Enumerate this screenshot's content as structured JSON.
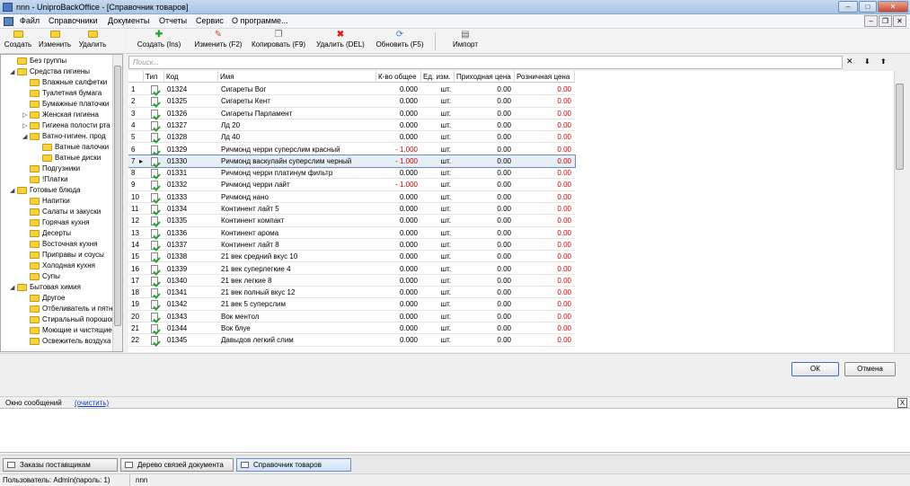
{
  "window": {
    "title": "nnn - UniproBackOffice - [Справочник товаров]",
    "min": "–",
    "max": "□",
    "close": "✕"
  },
  "menu": [
    "Файл",
    "Справочники",
    "Документы",
    "Отчеты",
    "Сервис",
    "О программе..."
  ],
  "mdi": {
    "min": "–",
    "restore": "❐",
    "close": "✕"
  },
  "tree_toolbar": [
    "Создать",
    "Изменить",
    "Удалить"
  ],
  "main_toolbar": [
    "Создать (Ins)",
    "Изменить (F2)",
    "Копировать (F9)",
    "Удалить (DEL)",
    "Обновить (F5)",
    "Импорт"
  ],
  "icons": {
    "create": "plus-icon",
    "edit": "pencil-icon",
    "copy": "copy-icon",
    "delete": "red-x-icon",
    "refresh": "refresh-icon",
    "import": "import-icon"
  },
  "search": {
    "placeholder": "Поиск...",
    "clear": "✕",
    "down": "⬇",
    "up": "⬆"
  },
  "tree": [
    {
      "label": "Без группы",
      "level": 0,
      "expander": ""
    },
    {
      "label": "Средства гигиены",
      "level": 0,
      "expander": "◢"
    },
    {
      "label": "Влажные салфетки",
      "level": 1,
      "expander": ""
    },
    {
      "label": "Туалетная бумага",
      "level": 1,
      "expander": ""
    },
    {
      "label": "Бумажные платочки",
      "level": 1,
      "expander": ""
    },
    {
      "label": "Женская гигиена",
      "level": 1,
      "expander": "▷"
    },
    {
      "label": "Гигиена полости рта",
      "level": 1,
      "expander": "▷"
    },
    {
      "label": "Ватно-гигиен. прод",
      "level": 1,
      "expander": "◢"
    },
    {
      "label": "Ватные палочки",
      "level": 2,
      "expander": ""
    },
    {
      "label": "Ватные диски",
      "level": 2,
      "expander": ""
    },
    {
      "label": "Подгузники",
      "level": 1,
      "expander": ""
    },
    {
      "label": "!Платки",
      "level": 1,
      "expander": ""
    },
    {
      "label": "Готовые блюда",
      "level": 0,
      "expander": "◢"
    },
    {
      "label": "Напитки",
      "level": 1,
      "expander": ""
    },
    {
      "label": "Салаты и закуски",
      "level": 1,
      "expander": ""
    },
    {
      "label": "Горячая кухня",
      "level": 1,
      "expander": ""
    },
    {
      "label": "Десерты",
      "level": 1,
      "expander": ""
    },
    {
      "label": "Восточная кухня",
      "level": 1,
      "expander": ""
    },
    {
      "label": "Приправы и соусы",
      "level": 1,
      "expander": ""
    },
    {
      "label": "Холодная кухня",
      "level": 1,
      "expander": ""
    },
    {
      "label": "Супы",
      "level": 1,
      "expander": ""
    },
    {
      "label": "Бытовая химия",
      "level": 0,
      "expander": "◢"
    },
    {
      "label": "Другое",
      "level": 1,
      "expander": ""
    },
    {
      "label": "Отбеливатель и пятно",
      "level": 1,
      "expander": ""
    },
    {
      "label": "Стиральный порошок",
      "level": 1,
      "expander": ""
    },
    {
      "label": "Моющие и чистящие",
      "level": 1,
      "expander": ""
    },
    {
      "label": "Освежитель воздуха",
      "level": 1,
      "expander": ""
    }
  ],
  "grid": {
    "columns": [
      "Тип",
      "Код",
      "Имя",
      "К-во общее",
      "Ед. изм.",
      "Приходная цена",
      "Розничная цена"
    ],
    "selected_marker": "▸",
    "rows": [
      {
        "n": "1",
        "code": "01324",
        "name": "Сигареты Вог",
        "qty": "0.000",
        "unit": "шт.",
        "in": "0.00",
        "retail": "0.00"
      },
      {
        "n": "2",
        "code": "01325",
        "name": "Сигареты Кент",
        "qty": "0.000",
        "unit": "шт.",
        "in": "0.00",
        "retail": "0.00"
      },
      {
        "n": "3",
        "code": "01326",
        "name": "Сигареты Парламент",
        "qty": "0.000",
        "unit": "шт.",
        "in": "0.00",
        "retail": "0.00"
      },
      {
        "n": "4",
        "code": "01327",
        "name": "Лд 20",
        "qty": "0.000",
        "unit": "шт.",
        "in": "0.00",
        "retail": "0.00"
      },
      {
        "n": "5",
        "code": "01328",
        "name": "Лд 40",
        "qty": "0.000",
        "unit": "шт.",
        "in": "0.00",
        "retail": "0.00"
      },
      {
        "n": "6",
        "code": "01329",
        "name": "Ричмонд черри суперслим красный",
        "qty": "- 1.000",
        "unit": "шт.",
        "in": "0.00",
        "retail": "0.00",
        "neg": true
      },
      {
        "n": "7",
        "code": "01330",
        "name": "Ричмонд васкулайн суперслим черный",
        "qty": "- 1.000",
        "unit": "шт.",
        "in": "0.00",
        "retail": "0.00",
        "neg": true,
        "sel": true
      },
      {
        "n": "8",
        "code": "01331",
        "name": "Ричмонд черри платинум фильтр",
        "qty": "0.000",
        "unit": "шт.",
        "in": "0.00",
        "retail": "0.00"
      },
      {
        "n": "9",
        "code": "01332",
        "name": "Ричмонд черри лайт",
        "qty": "- 1.000",
        "unit": "шт.",
        "in": "0.00",
        "retail": "0.00",
        "neg": true
      },
      {
        "n": "10",
        "code": "01333",
        "name": "Ричмонд нано",
        "qty": "0.000",
        "unit": "шт.",
        "in": "0.00",
        "retail": "0.00"
      },
      {
        "n": "11",
        "code": "01334",
        "name": "Континент лайт 5",
        "qty": "0.000",
        "unit": "шт.",
        "in": "0.00",
        "retail": "0.00"
      },
      {
        "n": "12",
        "code": "01335",
        "name": "Континент компакт",
        "qty": "0.000",
        "unit": "шт.",
        "in": "0.00",
        "retail": "0.00"
      },
      {
        "n": "13",
        "code": "01336",
        "name": "Континент арома",
        "qty": "0.000",
        "unit": "шт.",
        "in": "0.00",
        "retail": "0.00"
      },
      {
        "n": "14",
        "code": "01337",
        "name": "Континент лайт 8",
        "qty": "0.000",
        "unit": "шт.",
        "in": "0.00",
        "retail": "0.00"
      },
      {
        "n": "15",
        "code": "01338",
        "name": "21 век средний вкус 10",
        "qty": "0.000",
        "unit": "шт.",
        "in": "0.00",
        "retail": "0.00"
      },
      {
        "n": "16",
        "code": "01339",
        "name": "21 век суперлегкие 4",
        "qty": "0.000",
        "unit": "шт.",
        "in": "0.00",
        "retail": "0.00"
      },
      {
        "n": "17",
        "code": "01340",
        "name": "21 век легкие 8",
        "qty": "0.000",
        "unit": "шт.",
        "in": "0.00",
        "retail": "0.00"
      },
      {
        "n": "18",
        "code": "01341",
        "name": "21 век полный вкус 12",
        "qty": "0.000",
        "unit": "шт.",
        "in": "0.00",
        "retail": "0.00"
      },
      {
        "n": "19",
        "code": "01342",
        "name": "21 век 5 суперслим",
        "qty": "0.000",
        "unit": "шт.",
        "in": "0.00",
        "retail": "0.00"
      },
      {
        "n": "20",
        "code": "01343",
        "name": "Вок ментол",
        "qty": "0.000",
        "unit": "шт.",
        "in": "0.00",
        "retail": "0.00"
      },
      {
        "n": "21",
        "code": "01344",
        "name": "Вок блуе",
        "qty": "0.000",
        "unit": "шт.",
        "in": "0.00",
        "retail": "0.00"
      },
      {
        "n": "22",
        "code": "01345",
        "name": "Давыдов легкий слим",
        "qty": "0.000",
        "unit": "шт.",
        "in": "0.00",
        "retail": "0.00"
      }
    ]
  },
  "dialog": {
    "ok": "ОК",
    "cancel": "Отмена"
  },
  "messages": {
    "title": "Окно сообщений",
    "clear": "(очистить)",
    "close": "X"
  },
  "tasks": [
    {
      "label": "Заказы поставщикам",
      "active": false
    },
    {
      "label": "Дерево связей документа",
      "active": false
    },
    {
      "label": "Справочник товаров",
      "active": true
    }
  ],
  "status": {
    "user": "Пользователь: Admin(пароль: 1)",
    "db": "nnn"
  },
  "colors": {
    "negative": "#d40000",
    "retail": "#d40000",
    "accent": "#6d8fc9"
  }
}
